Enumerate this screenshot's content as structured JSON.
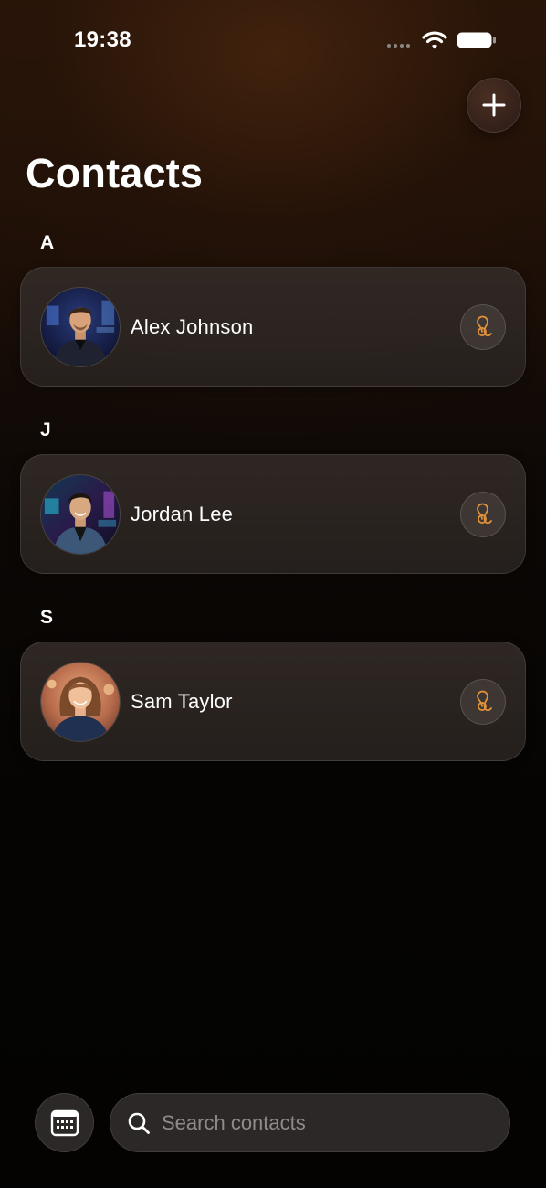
{
  "status_bar": {
    "time": "19:38",
    "icons": [
      "signal-dots-icon",
      "wifi-icon",
      "battery-icon"
    ]
  },
  "header": {
    "title": "Contacts",
    "add_button_icon": "plus-icon"
  },
  "sections": [
    {
      "letter": "A",
      "contacts": [
        {
          "name": "Alex Johnson",
          "action_icon": "leo-zodiac-icon"
        }
      ]
    },
    {
      "letter": "J",
      "contacts": [
        {
          "name": "Jordan Lee",
          "action_icon": "leo-zodiac-icon"
        }
      ]
    },
    {
      "letter": "S",
      "contacts": [
        {
          "name": "Sam Taylor",
          "action_icon": "leo-zodiac-icon"
        }
      ]
    }
  ],
  "bottom_bar": {
    "calendar_icon": "calendar-icon",
    "search": {
      "value": "",
      "placeholder": "Search contacts",
      "icon": "search-icon"
    }
  },
  "colors": {
    "accent_orange": "#e0913a",
    "card_background": "#2f2926",
    "text_primary": "#ffffff",
    "text_placeholder": "#8f8b88"
  }
}
